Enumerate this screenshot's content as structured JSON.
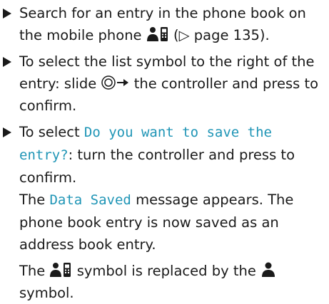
{
  "steps": [
    {
      "before_icon": "Search for an entry in the phone book on the mobile phone",
      "icon": "person-phone-icon",
      "after_icon": "(▷ page 135)."
    },
    {
      "before_icon": "To select the list symbol to the right of the entry: slide",
      "icon": "controller-slide-right-icon",
      "after_icon": "the controller and press to confirm."
    },
    {
      "prefix": "To select",
      "display_text": "Do you want to save the entry?",
      "suffix": ": turn the controller and press to confirm."
    }
  ],
  "notes": [
    {
      "prefix": "The",
      "display_text": "Data Saved",
      "suffix": "message appears. The phone book entry is now saved as an address book entry."
    },
    {
      "prefix": "The",
      "icon_a": "person-phone-icon",
      "middle": "symbol is replaced by the",
      "icon_b": "person-icon",
      "suffix": "symbol."
    }
  ],
  "colors": {
    "display_text": "#1f95b6",
    "body_text": "#1a1a1a"
  }
}
